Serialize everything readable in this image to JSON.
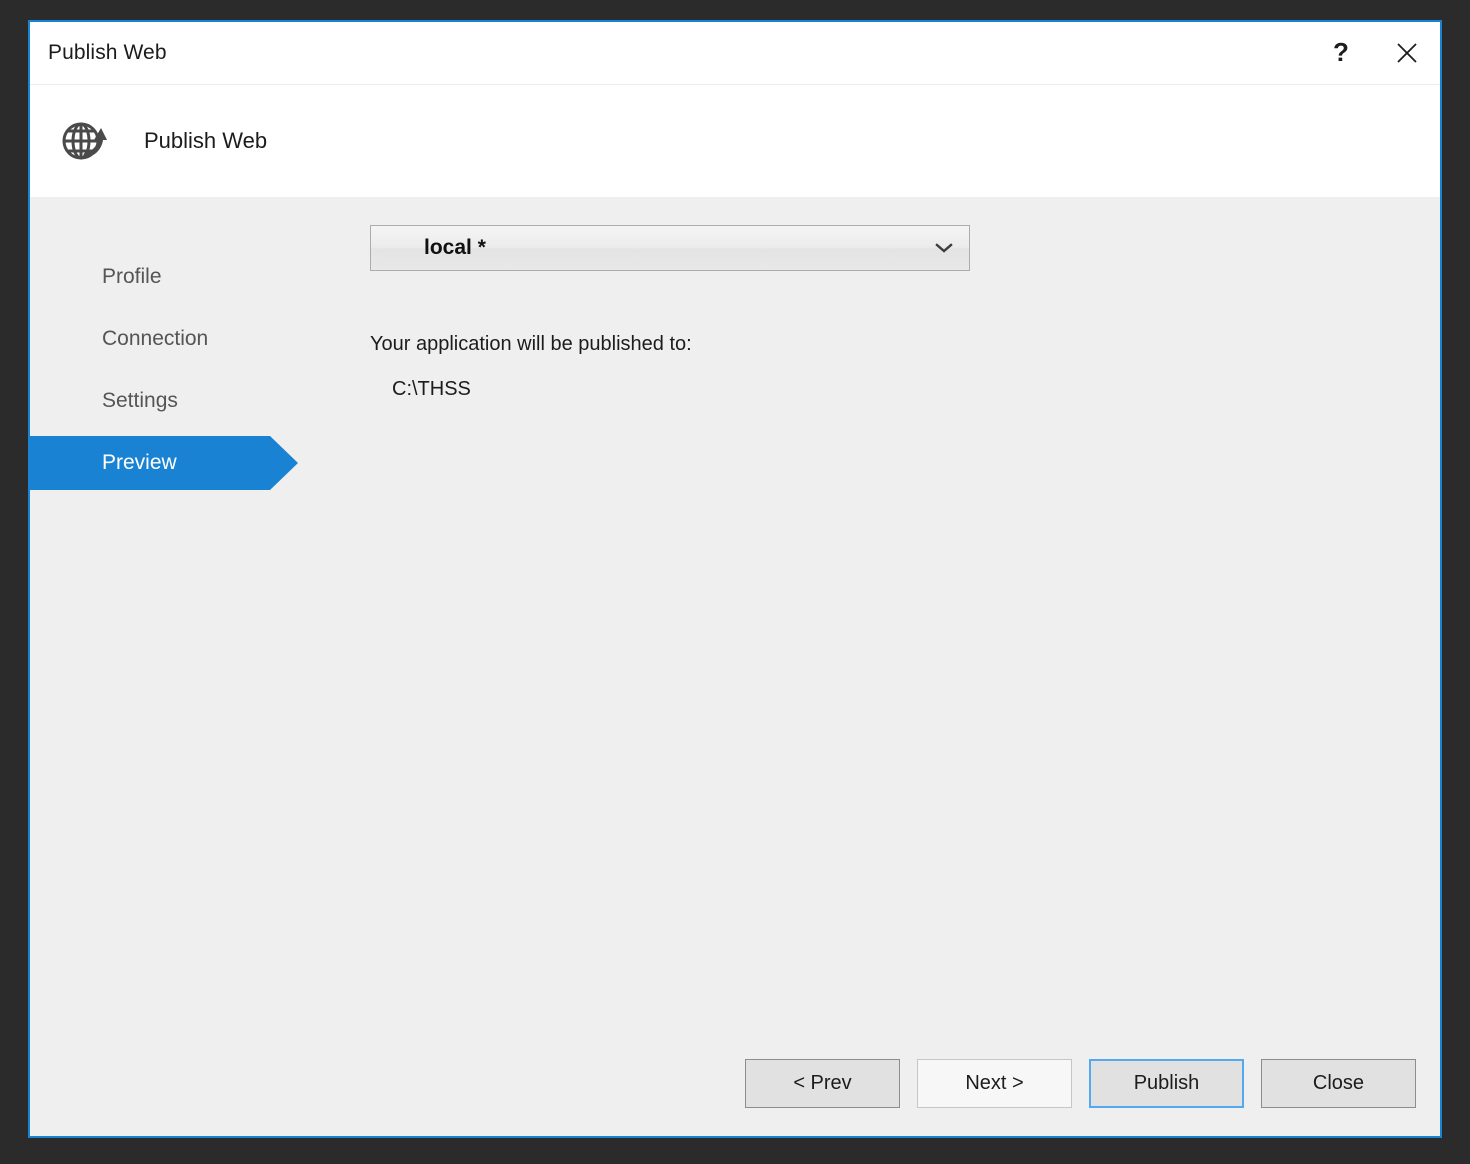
{
  "window": {
    "title": "Publish Web",
    "help_label": "?",
    "close_icon": "close-icon"
  },
  "header": {
    "title": "Publish Web",
    "icon": "globe-publish-icon"
  },
  "sidebar": {
    "items": [
      {
        "label": "Profile",
        "selected": false
      },
      {
        "label": "Connection",
        "selected": false
      },
      {
        "label": "Settings",
        "selected": false
      },
      {
        "label": "Preview",
        "selected": true
      }
    ]
  },
  "main": {
    "profile_select": {
      "value": "local *",
      "chevron_icon": "chevron-down-icon"
    },
    "publish_to_label": "Your application will be published to:",
    "publish_to_path": "C:\\THSS"
  },
  "footer": {
    "prev_label": "< Prev",
    "next_label": "Next >",
    "publish_label": "Publish",
    "close_label": "Close"
  },
  "colors": {
    "accent": "#1a82d2",
    "focus_ring": "#53a9ef",
    "window_border": "#1a82d2",
    "content_bg": "#efefef",
    "desktop_bg": "#2b2b2b"
  }
}
